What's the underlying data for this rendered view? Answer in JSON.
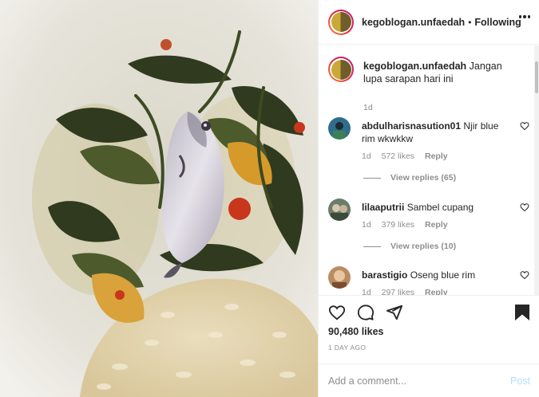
{
  "header": {
    "username": "kegoblogan.unfaedah",
    "separator": "•",
    "follow_status": "Following"
  },
  "caption": {
    "username": "kegoblogan.unfaedah",
    "text": "Jangan lupa sarapan hari ini",
    "time": "1d"
  },
  "comments": [
    {
      "username": "abdulharisnasution01",
      "text": "Njir blue rim wkwkkw",
      "time": "1d",
      "likes": "572 likes",
      "reply_label": "Reply",
      "view_replies": "View replies (65)"
    },
    {
      "username": "lilaaputrii",
      "text": "Sambel cupang",
      "time": "1d",
      "likes": "379 likes",
      "reply_label": "Reply",
      "view_replies": "View replies (10)"
    },
    {
      "username": "barastigio",
      "text": "Oseng blue rim",
      "time": "1d",
      "likes": "297 likes",
      "reply_label": "Reply"
    }
  ],
  "post": {
    "likes": "90,480 likes",
    "date": "1 DAY AGO"
  },
  "add_comment": {
    "placeholder": "Add a comment...",
    "post_label": "Post"
  },
  "icons": {
    "like": "heart-icon",
    "comment": "comment-icon",
    "share": "share-icon",
    "save": "bookmark-icon",
    "more": "more-options-icon"
  },
  "colors": {
    "text": "#262626",
    "secondary": "#8e8e8e",
    "post_disabled": "#b2dffc",
    "border": "#efefef"
  }
}
